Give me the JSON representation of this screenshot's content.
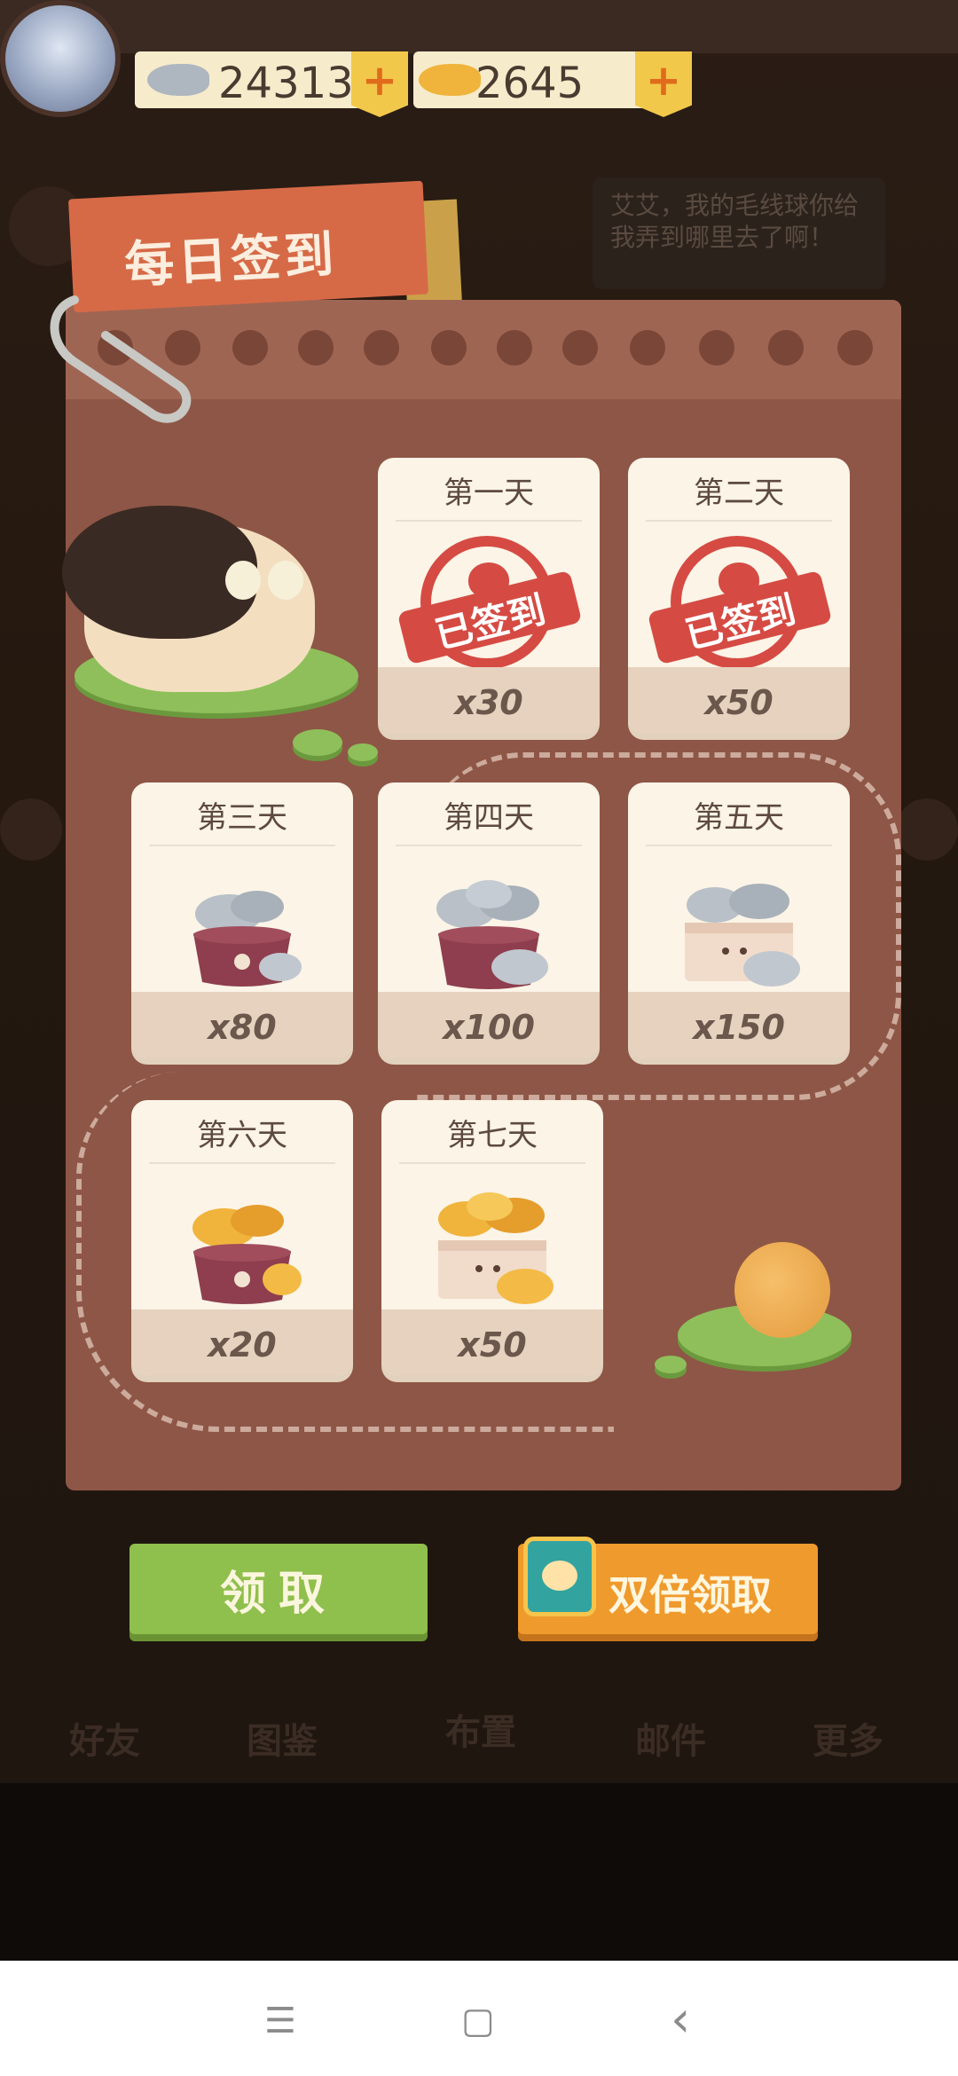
{
  "currency": {
    "silver_fish": "24313",
    "gold_fish": "2645",
    "plus_label": "+"
  },
  "background": {
    "bubble_text": "艾艾，我的毛线球你给我弄到哪里去了啊！",
    "nav": [
      "好友",
      "图鉴",
      "布置",
      "邮件",
      "更多"
    ]
  },
  "dialog": {
    "title": "每日签到",
    "days": [
      {
        "label": "第一天",
        "amount": "x30",
        "reward": "silver-fish",
        "signed": true
      },
      {
        "label": "第二天",
        "amount": "x50",
        "reward": "silver-fish",
        "signed": true
      },
      {
        "label": "第三天",
        "amount": "x80",
        "reward": "silver-fish-bowl",
        "signed": false
      },
      {
        "label": "第四天",
        "amount": "x100",
        "reward": "silver-fish-bowl",
        "signed": false
      },
      {
        "label": "第五天",
        "amount": "x150",
        "reward": "silver-fish-box",
        "signed": false
      },
      {
        "label": "第六天",
        "amount": "x20",
        "reward": "gold-fish-bowl",
        "signed": false
      },
      {
        "label": "第七天",
        "amount": "x50",
        "reward": "gold-fish-box",
        "signed": false
      }
    ],
    "stamp_text": "已签到",
    "claim_button": "领取",
    "double_claim_button": "双倍领取"
  },
  "system_nav": {
    "menu_icon": "☰",
    "home_icon": "▢",
    "back_icon": "‹"
  },
  "colors": {
    "board": "#8e5646",
    "tab": "#d66a47",
    "claim_green": "#8fbf4c",
    "double_orange": "#ef9a2c",
    "stamp_red": "#d54b43"
  }
}
